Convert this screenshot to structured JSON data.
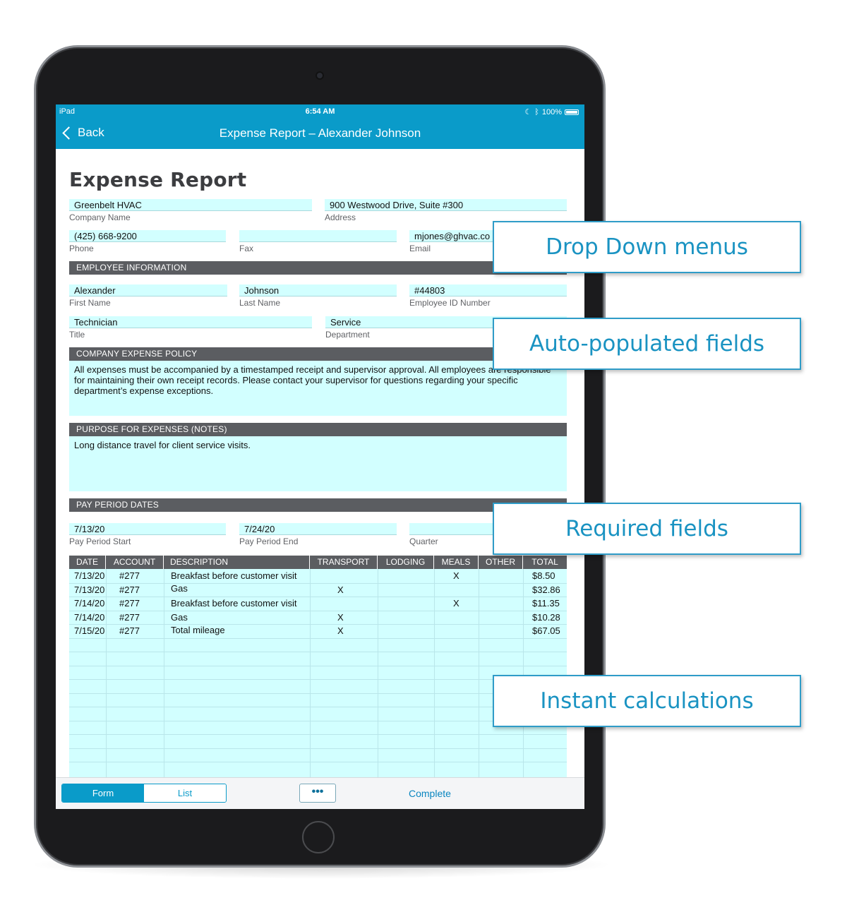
{
  "status_bar": {
    "device": "iPad",
    "time": "6:54 AM",
    "battery": "100%"
  },
  "nav": {
    "back_label": "Back",
    "title": "Expense Report – Alexander Johnson"
  },
  "form": {
    "heading": "Expense Report",
    "company_name": {
      "value": "Greenbelt HVAC",
      "label": "Company Name"
    },
    "address": {
      "value": "900 Westwood Drive, Suite #300",
      "label": "Address"
    },
    "phone": {
      "value": "(425) 668-9200",
      "label": "Phone"
    },
    "fax": {
      "value": "",
      "label": "Fax"
    },
    "email": {
      "value": "mjones@ghvac.co",
      "label": "Email"
    },
    "employee_section": "EMPLOYEE INFORMATION",
    "first_name": {
      "value": "Alexander",
      "label": "First Name"
    },
    "last_name": {
      "value": "Johnson",
      "label": "Last Name"
    },
    "employee_id": {
      "value": "#44803",
      "label": "Employee ID Number"
    },
    "title": {
      "value": "Technician",
      "label": "Title"
    },
    "department": {
      "value": "Service",
      "label": "Department"
    },
    "policy_section": "COMPANY EXPENSE POLICY",
    "policy_text": "All expenses must be accompanied by a timestamped receipt and supervisor approval. All employees are responsible for maintaining their own receipt records. Please contact your supervisor for questions regarding your specific department’s expense exceptions.",
    "purpose_section": "PURPOSE FOR EXPENSES (NOTES)",
    "purpose_text": "Long distance travel for client service visits.",
    "pay_section": "PAY PERIOD DATES",
    "pay_start": {
      "value": "7/13/20",
      "label": "Pay Period Start"
    },
    "pay_end": {
      "value": "7/24/20",
      "label": "Pay Period End"
    },
    "quarter": {
      "value": "",
      "label": "Quarter"
    }
  },
  "table": {
    "headers": [
      "DATE",
      "ACCOUNT",
      "DESCRIPTION",
      "TRANSPORT",
      "LODGING",
      "MEALS",
      "OTHER",
      "TOTAL"
    ],
    "rows": [
      {
        "date": "7/13/20",
        "account": "#277",
        "description": "Breakfast before customer visit",
        "transport": "",
        "lodging": "",
        "meals": "X",
        "other": "",
        "total": "$8.50"
      },
      {
        "date": "7/13/20",
        "account": "#277",
        "description": "Gas",
        "transport": "X",
        "lodging": "",
        "meals": "",
        "other": "",
        "total": "$32.86"
      },
      {
        "date": "7/14/20",
        "account": "#277",
        "description": "Breakfast before customer visit",
        "transport": "",
        "lodging": "",
        "meals": "X",
        "other": "",
        "total": "$11.35"
      },
      {
        "date": "7/14/20",
        "account": "#277",
        "description": "Gas",
        "transport": "X",
        "lodging": "",
        "meals": "",
        "other": "",
        "total": "$10.28"
      },
      {
        "date": "7/15/20",
        "account": "#277",
        "description": "Total mileage",
        "transport": "X",
        "lodging": "",
        "meals": "",
        "other": "",
        "total": "$67.05"
      }
    ]
  },
  "toolbar": {
    "form_tab": "Form",
    "list_tab": "List",
    "more": "•••",
    "complete": "Complete"
  },
  "callouts": {
    "dropdown": "Drop Down menus",
    "autopop": "Auto-populated fields",
    "required": "Required fields",
    "instant": "Instant calculations"
  },
  "colors": {
    "accent": "#0a9bc9",
    "field_bg": "#d2ffff",
    "section_bg": "#5b5d61",
    "callout_text": "#1a93c2"
  }
}
